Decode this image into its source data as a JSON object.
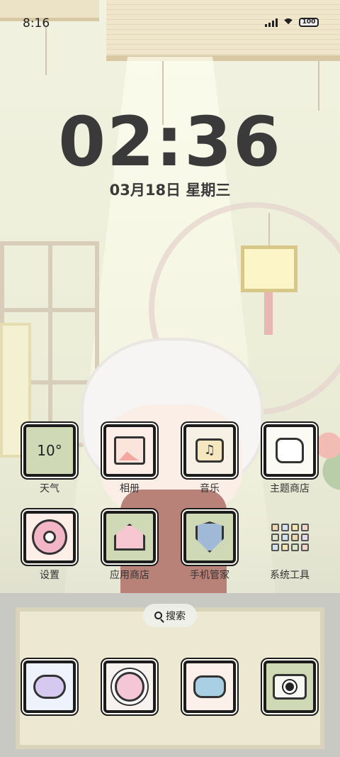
{
  "status_bar": {
    "time": "8:16",
    "battery": "100",
    "signal_icon": "cellular-signal-icon",
    "wifi_icon": "wifi-icon",
    "battery_icon": "battery-icon"
  },
  "lock_clock": {
    "time": "02:36",
    "date": "03月18日 星期三"
  },
  "apps": [
    {
      "label": "天气",
      "icon": "weather-widget-icon",
      "value": "10°"
    },
    {
      "label": "相册",
      "icon": "photo-album-icon"
    },
    {
      "label": "音乐",
      "icon": "music-icon"
    },
    {
      "label": "主题商店",
      "icon": "theme-store-icon"
    },
    {
      "label": "设置",
      "icon": "settings-flower-icon"
    },
    {
      "label": "应用商店",
      "icon": "app-store-house-icon"
    },
    {
      "label": "手机管家",
      "icon": "phone-manager-shield-icon"
    },
    {
      "label": "系统工具",
      "icon": "system-tools-folder-icon"
    }
  ],
  "search": {
    "label": "搜索",
    "icon": "search-icon"
  },
  "dock": [
    {
      "icon": "cloud-bunny-icon"
    },
    {
      "icon": "planet-icon"
    },
    {
      "icon": "chat-bubbles-icon"
    },
    {
      "icon": "camera-icon"
    }
  ],
  "colors": {
    "tile_border": "#1c1c1c",
    "clock_text": "#3a3a3a",
    "weather_tile": "#cfd9b5"
  }
}
